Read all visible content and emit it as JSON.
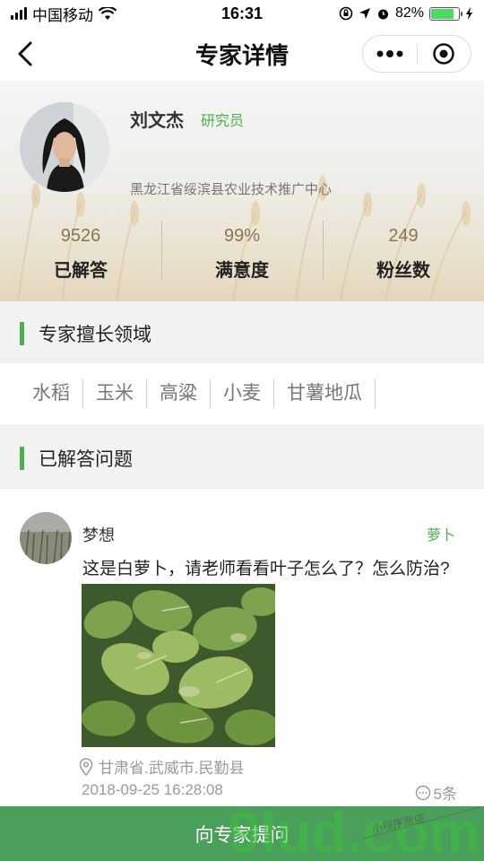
{
  "status_bar": {
    "carrier": "中国移动",
    "time": "16:31",
    "battery_percent": "82%",
    "battery_level": 0.82,
    "battery_color": "#4cd964"
  },
  "nav": {
    "title": "专家详情",
    "back_icon": "chevron-left-icon",
    "more_icon": "more-dots-icon",
    "close_icon": "target-circle-icon"
  },
  "expert": {
    "name": "刘文杰",
    "title": "研究员",
    "organization": "黑龙江省绥滨县农业技术推广中心",
    "stats": [
      {
        "value": "9526",
        "label": "已解答"
      },
      {
        "value": "99%",
        "label": "满意度"
      },
      {
        "value": "249",
        "label": "粉丝数"
      }
    ]
  },
  "sections": {
    "expertise_title": "专家擅长领域",
    "answered_title": "已解答问题"
  },
  "expertise_tags": [
    "水稻",
    "玉米",
    "高粱",
    "小麦",
    "甘薯地瓜"
  ],
  "question": {
    "user": "梦想",
    "crop_tag": "萝卜",
    "text": "这是白萝卜，请老师看看叶子怎么了？怎么防治?",
    "location": "甘肃省.武威市.民勤县",
    "datetime": "2018-09-25 16:28:08",
    "reply_count": "5条"
  },
  "ask_button_label": "向专家提问",
  "watermark": {
    "text": "9lud.com",
    "subtext": "小程序商店"
  },
  "colors": {
    "accent": "#4caf50",
    "button": "#4aa05a"
  }
}
